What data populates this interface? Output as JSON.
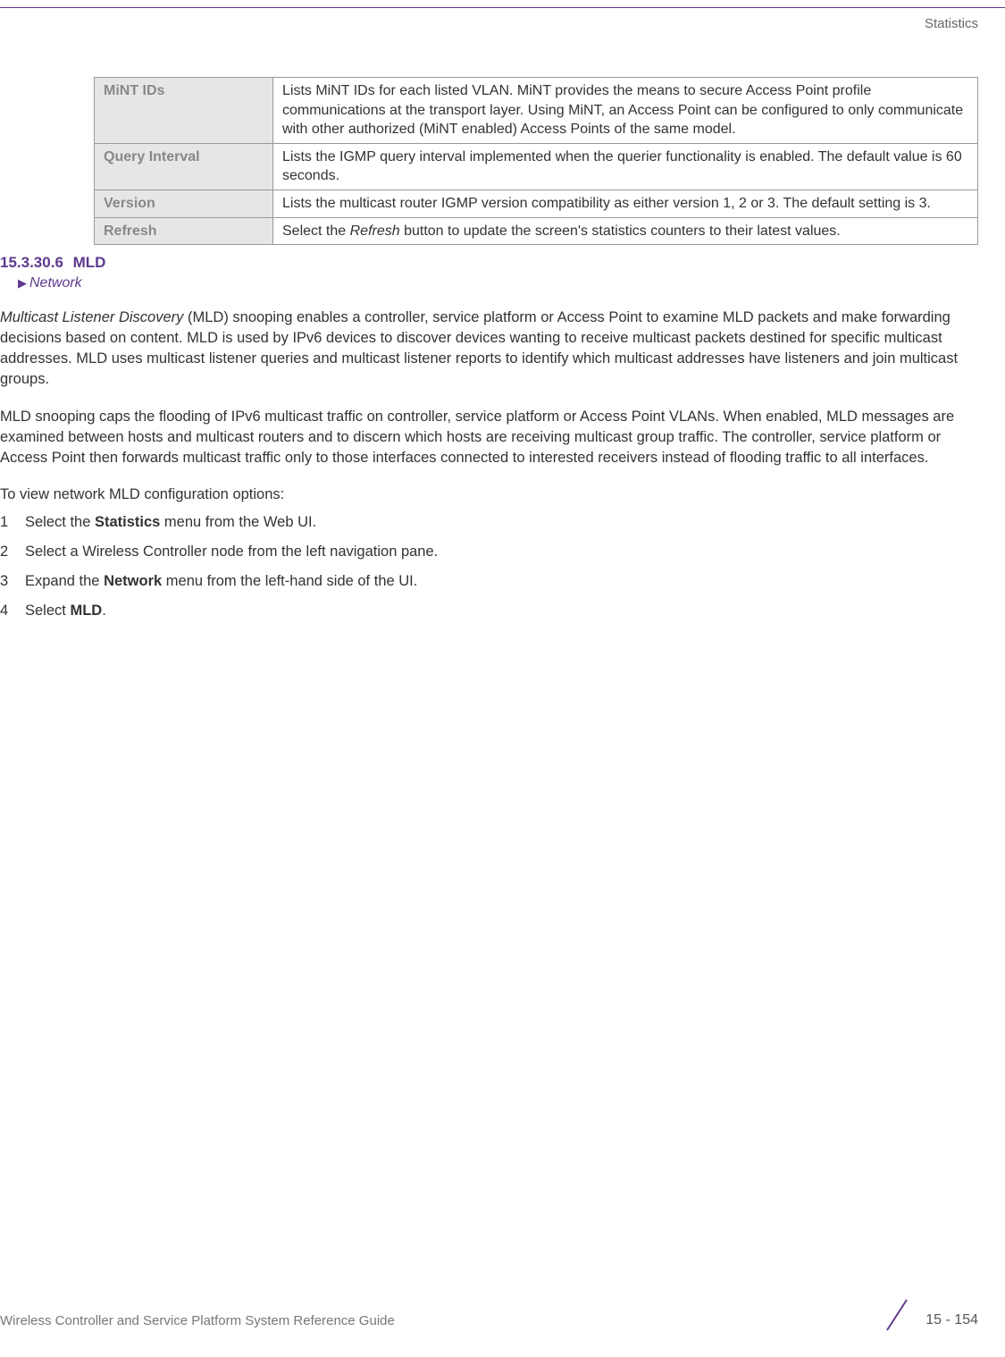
{
  "header": {
    "chapter": "Statistics"
  },
  "table": {
    "rows": [
      {
        "label": "MiNT IDs",
        "desc": "Lists MiNT IDs for each listed VLAN. MiNT provides the means to secure Access Point profile communications at the transport layer. Using MiNT, an Access Point can be configured to only communicate with other authorized (MiNT enabled) Access Points of the same model."
      },
      {
        "label": "Query Interval",
        "desc": "Lists the IGMP query interval implemented when the querier functionality is enabled. The default value is 60 seconds."
      },
      {
        "label": "Version",
        "desc": "Lists the multicast router IGMP version compatibility as either version 1, 2 or 3. The default setting is 3."
      },
      {
        "label": "Refresh",
        "desc_pre": "Select the ",
        "desc_em": "Refresh",
        "desc_post": " button to update the screen's statistics counters to their latest values."
      }
    ]
  },
  "section": {
    "number": "15.3.30.6",
    "title": "MLD",
    "breadcrumb": "Network"
  },
  "paragraphs": {
    "p1_em": "Multicast Listener Discovery",
    "p1_rest": " (MLD) snooping enables a controller, service platform or Access Point to examine MLD packets and make forwarding decisions based on content. MLD is used by IPv6 devices to discover devices wanting to receive multicast packets destined for specific multicast addresses. MLD uses multicast listener queries and multicast listener reports to identify which multicast addresses have listeners and join multicast groups.",
    "p2": "MLD snooping caps the flooding of IPv6 multicast traffic on controller, service platform or Access Point VLANs. When enabled, MLD messages are examined between hosts and multicast routers and to discern which hosts are receiving multicast group traffic. The controller, service platform or Access Point then forwards multicast traffic only to those interfaces connected to interested receivers instead of flooding traffic to all interfaces.",
    "p3": "To view network MLD configuration options:"
  },
  "steps": {
    "s1_pre": "Select the ",
    "s1_bold": "Statistics",
    "s1_post": " menu from the Web UI.",
    "s2": "Select a Wireless Controller node from the left navigation pane.",
    "s3_pre": "Expand the ",
    "s3_bold": "Network",
    "s3_post": " menu from the left-hand side of the UI.",
    "s4_pre": "Select ",
    "s4_bold": "MLD",
    "s4_post": "."
  },
  "footer": {
    "guide": "Wireless Controller and Service Platform System Reference Guide",
    "page": "15 - 154"
  }
}
